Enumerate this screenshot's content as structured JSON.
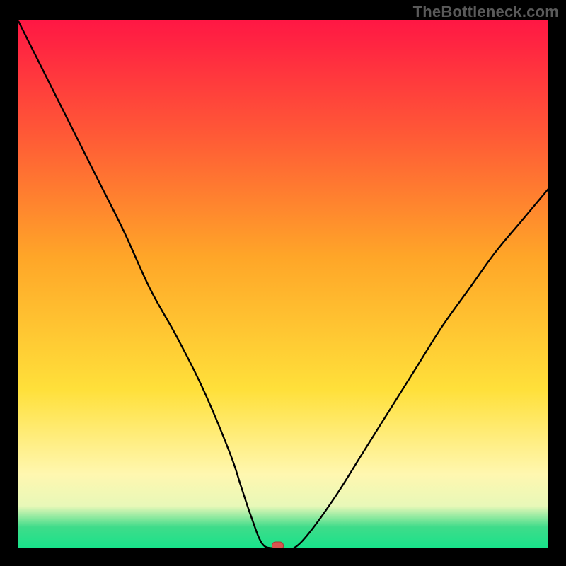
{
  "watermark": "TheBottleneck.com",
  "colors": {
    "black": "#000000",
    "watermark": "#5a5a5a",
    "line": "#000000",
    "marker_fill": "#d9534f",
    "marker_stroke": "#a83a36",
    "gradient_top": "#ff1744",
    "gradient_mid1": "#ff5a36",
    "gradient_mid2": "#ffa628",
    "gradient_mid3": "#ffe03a",
    "gradient_pale": "#fff7b0",
    "gradient_pale2": "#e8f8b8",
    "gradient_green": "#3fdc8a",
    "gradient_bottom": "#17e28a"
  },
  "chart_data": {
    "type": "line",
    "title": "",
    "xlabel": "",
    "ylabel": "",
    "xlim": [
      0,
      100
    ],
    "ylim": [
      0,
      100
    ],
    "x": [
      0,
      5,
      10,
      15,
      20,
      25,
      30,
      35,
      40,
      42,
      44,
      46,
      48,
      50,
      52,
      55,
      60,
      65,
      70,
      75,
      80,
      85,
      90,
      95,
      100
    ],
    "values": [
      100,
      90,
      80,
      70,
      60,
      49,
      40,
      30,
      18,
      12,
      6,
      1,
      0,
      0,
      0,
      3,
      10,
      18,
      26,
      34,
      42,
      49,
      56,
      62,
      68
    ],
    "marker": {
      "x": 49,
      "y": 0
    },
    "annotations": []
  }
}
